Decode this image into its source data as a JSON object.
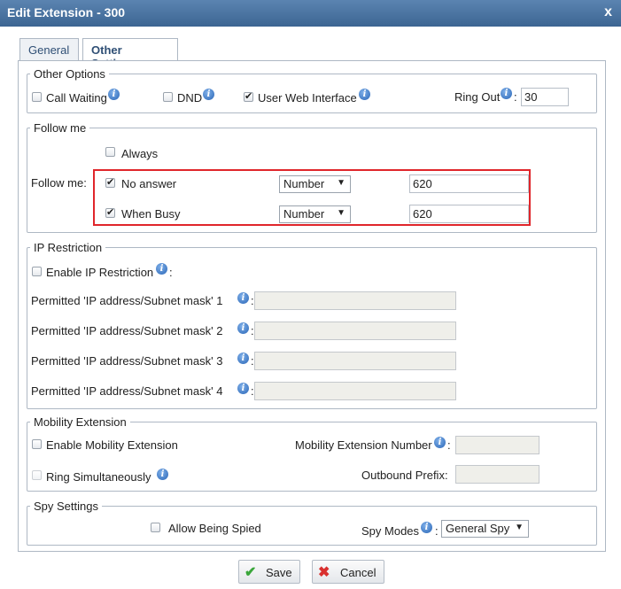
{
  "dialog": {
    "title": "Edit Extension - 300",
    "close_label": "x"
  },
  "tabs": [
    {
      "label": "General",
      "active": false
    },
    {
      "label": "Other Settings",
      "active": true
    }
  ],
  "other_options": {
    "legend": "Other Options",
    "call_waiting": {
      "label": "Call Waiting",
      "checked": false
    },
    "dnd": {
      "label": "DND",
      "checked": false
    },
    "user_web_interface": {
      "label": "User Web Interface",
      "checked": true
    },
    "ring_out": {
      "label": "Ring Out",
      "colon": ":",
      "value": "30"
    }
  },
  "follow_me": {
    "legend": "Follow me",
    "field_label": "Follow me:",
    "always": {
      "label": "Always",
      "checked": false
    },
    "no_answer": {
      "label": "No answer",
      "checked": true,
      "type": "Number",
      "value": "620"
    },
    "when_busy": {
      "label": "When Busy",
      "checked": true,
      "type": "Number",
      "value": "620"
    }
  },
  "ip_restriction": {
    "legend": "IP Restriction",
    "enable": {
      "label": "Enable IP Restriction",
      "colon": ":",
      "checked": false
    },
    "rows": [
      {
        "label": "Permitted 'IP address/Subnet mask'  1",
        "colon": ":",
        "value": ""
      },
      {
        "label": "Permitted 'IP address/Subnet mask'  2",
        "colon": ":",
        "value": ""
      },
      {
        "label": "Permitted 'IP address/Subnet mask'  3",
        "colon": ":",
        "value": ""
      },
      {
        "label": "Permitted 'IP address/Subnet mask'  4",
        "colon": ":",
        "value": ""
      }
    ]
  },
  "mobility": {
    "legend": "Mobility Extension",
    "enable": {
      "label": "Enable Mobility Extension",
      "checked": false
    },
    "ring_simultaneously": {
      "label": "Ring Simultaneously",
      "checked": false
    },
    "number_label": "Mobility Extension Number",
    "number_colon": ":",
    "number_value": "",
    "prefix_label": "Outbound Prefix:",
    "prefix_value": ""
  },
  "spy": {
    "legend": "Spy Settings",
    "allow": {
      "label": "Allow Being Spied",
      "checked": false
    },
    "modes_label": "Spy Modes",
    "modes_colon": ":",
    "modes_value": "General Spy"
  },
  "buttons": {
    "save": "Save",
    "cancel": "Cancel"
  },
  "colors": {
    "title_bar": "#4a74a3",
    "highlight": "#e0262b",
    "save_icon": "#3aa63a",
    "cancel_icon": "#d9302e"
  },
  "icons": [
    "info-icon",
    "checkbox",
    "dropdown-arrow-icon",
    "checkmark-icon",
    "cross-icon",
    "close-icon"
  ]
}
